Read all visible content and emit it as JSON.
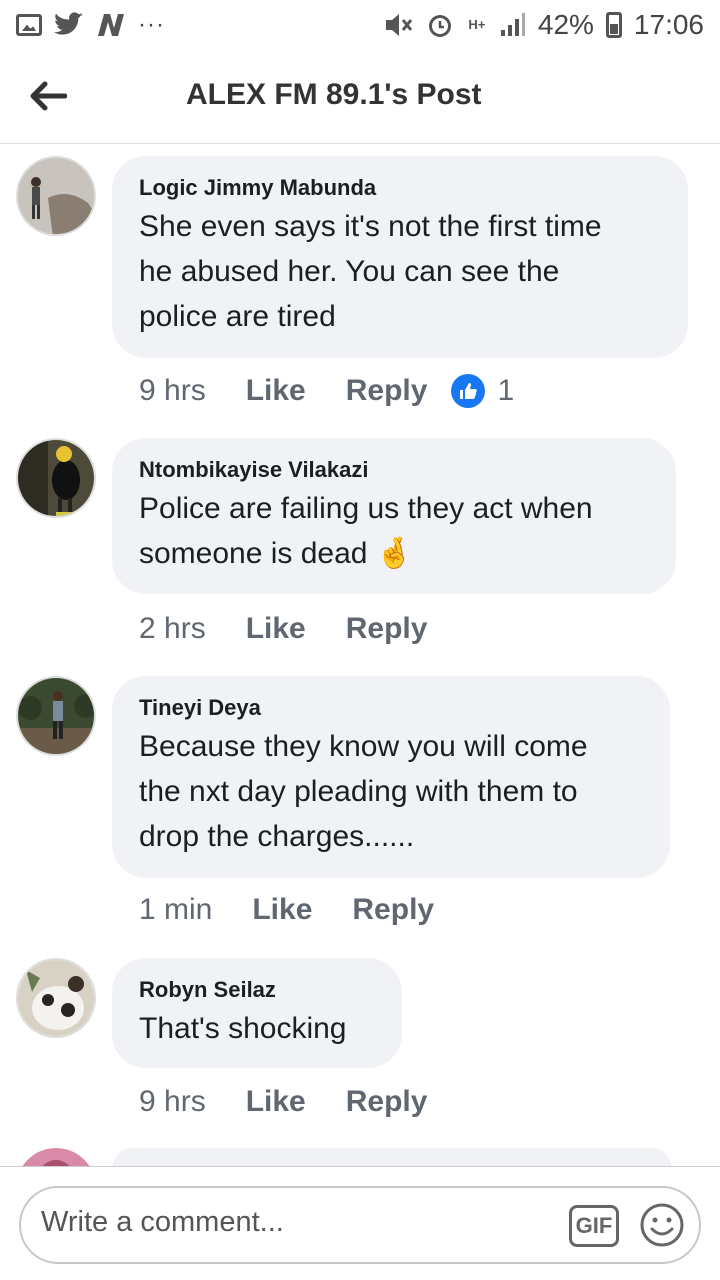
{
  "status_bar": {
    "icons_left": [
      "image-icon",
      "twitter-icon",
      "n-icon",
      "more-icon"
    ],
    "overflow": "···",
    "battery": "42%",
    "time": "17:06",
    "network": "H+"
  },
  "header": {
    "title": "ALEX FM 89.1's Post"
  },
  "comments": [
    {
      "author": "Logic Jimmy Mabunda",
      "text_lines": [
        "She even says it's not the first time",
        "he abused her. You can see the",
        "police are tired"
      ],
      "time": "9 hrs",
      "like": "Like",
      "reply": "Reply",
      "reaction_count": "1"
    },
    {
      "author": "Ntombikayise Vilakazi",
      "text_lines": [
        "Police are failing us they act when",
        "someone is dead"
      ],
      "emoji": "🤞",
      "time": "2 hrs",
      "like": "Like",
      "reply": "Reply"
    },
    {
      "author": "Tineyi Deya",
      "text_lines": [
        "Because they know you will come",
        "the nxt day pleading with them to",
        "drop the charges......"
      ],
      "time": "1 min",
      "like": "Like",
      "reply": "Reply"
    },
    {
      "author": "Robyn Seilaz",
      "text_lines": [
        "That's shocking"
      ],
      "time": "9 hrs",
      "like": "Like",
      "reply": "Reply"
    }
  ],
  "composer": {
    "placeholder": "Write a comment...",
    "gif_label": "GIF"
  },
  "colors": {
    "bubble": "#f0f2f5",
    "like_blue": "#1877f2",
    "meta_gray": "#606770"
  }
}
